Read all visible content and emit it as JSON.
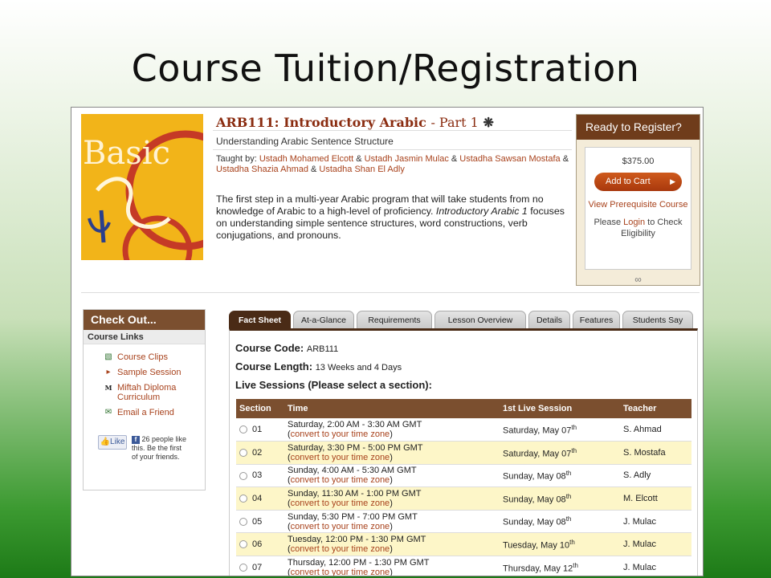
{
  "slide_title": "Course Tuition/Registration",
  "course": {
    "title_code": "ARB111: Introductory Arabic",
    "title_part": "- Part 1",
    "subtitle": "Understanding Arabic Sentence Structure",
    "taught_by_label": "Taught by:",
    "instructors": [
      "Ustadh Mohamed Elcott",
      "Ustadh Jasmin Mulac",
      "Ustadha Sawsan Mostafa",
      "Ustadha Shazia Ahmad",
      "Ustadha Shan El Adly"
    ],
    "desc_1": "The first step in a multi-year Arabic program that will take students from no knowledge of Arabic to a high-level of proficiency. ",
    "desc_italic": "Introductory Arabic 1",
    "desc_2": " focuses on understanding simple sentence structures, word constructions, verb conjugations, and pronouns.",
    "cover_text": "Basic"
  },
  "register": {
    "heading": "Ready to Register?",
    "price": "$375.00",
    "cart_label": "Add to Cart",
    "prereq_link": "View Prerequisite Course",
    "login_prefix": "Please ",
    "login_link": "Login",
    "login_suffix": " to Check Eligibility"
  },
  "checkout": {
    "heading": "Check Out...",
    "subheading": "Course Links",
    "links": [
      {
        "label": "Course Clips",
        "icon": "film-icon"
      },
      {
        "label": "Sample Session",
        "icon": "session-icon"
      },
      {
        "label": "Miftah Diploma Curriculum",
        "icon": "miftah-logo-icon"
      },
      {
        "label": "Email a Friend",
        "icon": "email-icon"
      }
    ],
    "like_label": "Like",
    "like_text": "26 people like this. Be the first of your friends."
  },
  "tabs": [
    "Fact Sheet",
    "At-a-Glance",
    "Requirements",
    "Lesson Overview",
    "Details",
    "Features",
    "Students Say"
  ],
  "facts": {
    "code_label": "Course Code:",
    "code_value": "ARB111",
    "length_label": "Course Length:",
    "length_value": "13 Weeks and 4 Days",
    "sessions_label": "Live Sessions (Please select a section):"
  },
  "table": {
    "headers": [
      "Section",
      "Time",
      "1st Live Session",
      "Teacher"
    ],
    "tz_link": "convert to your time zone",
    "rows": [
      {
        "section": "01",
        "time": "Saturday, 2:00 AM - 3:30 AM GMT",
        "first": "Saturday, May 07",
        "suffix": "th",
        "teacher": "S. Ahmad"
      },
      {
        "section": "02",
        "time": "Saturday, 3:30 PM - 5:00 PM GMT",
        "first": "Saturday, May 07",
        "suffix": "th",
        "teacher": "S. Mostafa"
      },
      {
        "section": "03",
        "time": "Sunday, 4:00 AM - 5:30 AM GMT",
        "first": "Sunday, May 08",
        "suffix": "th",
        "teacher": "S. Adly"
      },
      {
        "section": "04",
        "time": "Sunday, 11:30 AM - 1:00 PM GMT",
        "first": "Sunday, May 08",
        "suffix": "th",
        "teacher": "M. Elcott"
      },
      {
        "section": "05",
        "time": "Sunday, 5:30 PM - 7:00 PM GMT",
        "first": "Sunday, May 08",
        "suffix": "th",
        "teacher": "J. Mulac"
      },
      {
        "section": "06",
        "time": "Tuesday, 12:00 PM - 1:30 PM GMT",
        "first": "Tuesday, May 10",
        "suffix": "th",
        "teacher": "J. Mulac"
      },
      {
        "section": "07",
        "time": "Thursday, 12:00 PM - 1:30 PM GMT",
        "first": "Thursday, May 12",
        "suffix": "th",
        "teacher": "J. Mulac"
      }
    ]
  }
}
